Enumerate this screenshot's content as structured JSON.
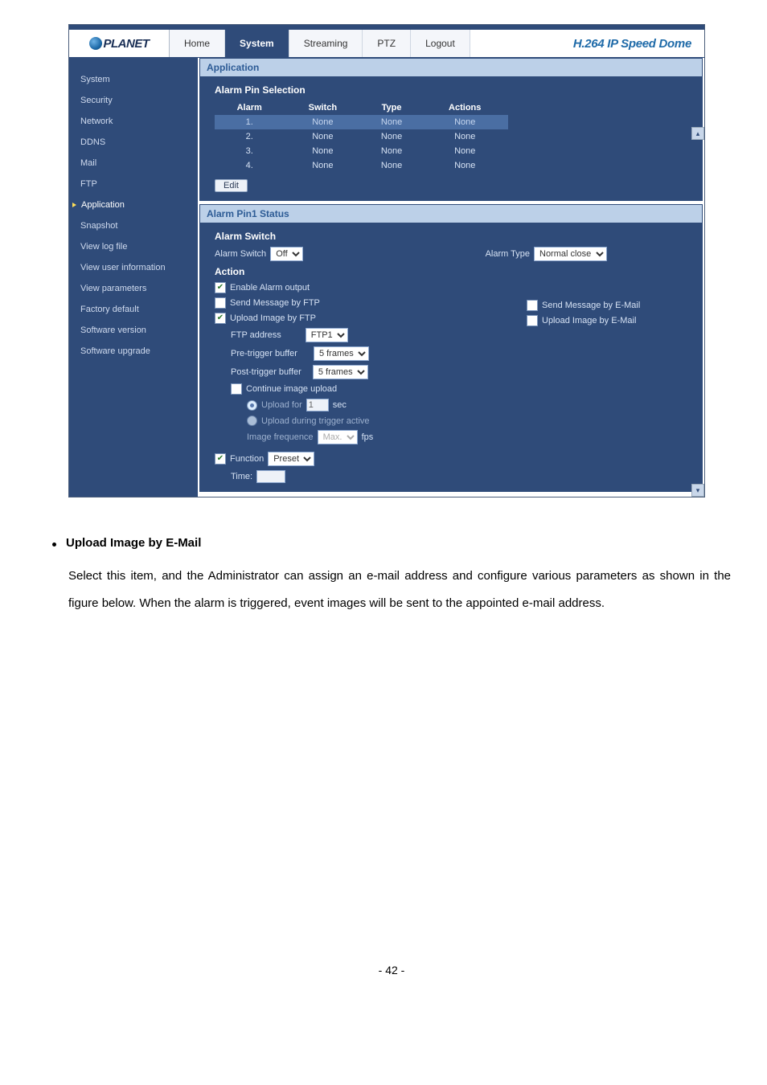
{
  "logo_text": "PLANET",
  "brand_slogan": "H.264 IP Speed Dome",
  "nav_tabs": [
    "Home",
    "System",
    "Streaming",
    "PTZ",
    "Logout"
  ],
  "nav_active_index": 1,
  "sidebar": {
    "items": [
      "System",
      "Security",
      "Network",
      "DDNS",
      "Mail",
      "FTP",
      "Application",
      "Snapshot",
      "View log file",
      "View user information",
      "View parameters",
      "Factory default",
      "Software version",
      "Software upgrade"
    ],
    "current_index": 6
  },
  "panel1": {
    "title": "Application",
    "sub": "Alarm Pin Selection",
    "columns": [
      "Alarm",
      "Switch",
      "Type",
      "Actions"
    ],
    "rows": [
      [
        "1.",
        "None",
        "None",
        "None"
      ],
      [
        "2.",
        "None",
        "None",
        "None"
      ],
      [
        "3.",
        "None",
        "None",
        "None"
      ],
      [
        "4.",
        "None",
        "None",
        "None"
      ]
    ],
    "selected_row": 0,
    "edit_label": "Edit"
  },
  "panel2": {
    "title": "Alarm Pin1 Status",
    "switch_sub": "Alarm Switch",
    "alarm_switch_label": "Alarm Switch",
    "alarm_switch_value": "Off",
    "alarm_type_label": "Alarm Type",
    "alarm_type_value": "Normal close",
    "action_label": "Action",
    "enable_alarm_output": "Enable Alarm output",
    "send_msg_ftp": "Send Message by FTP",
    "send_msg_email": "Send Message by E-Mail",
    "upload_img_ftp": "Upload Image by FTP",
    "upload_img_email": "Upload Image by E-Mail",
    "ftp_address_label": "FTP address",
    "ftp_address_value": "FTP1",
    "pre_trigger_label": "Pre-trigger buffer",
    "pre_trigger_value": "5  frames",
    "post_trigger_label": "Post-trigger buffer",
    "post_trigger_value": "5  frames",
    "continue_upload": "Continue image upload",
    "upload_for_label": "Upload for",
    "upload_for_value": "1",
    "upload_for_unit": "sec",
    "upload_during_active": "Upload during trigger active",
    "image_freq_label": "Image frequence",
    "image_freq_value": "Max.",
    "image_freq_unit": "fps",
    "function_label": "Function",
    "function_value": "Preset",
    "time_label": "Time:"
  },
  "doc": {
    "bullet_heading": "Upload Image by E-Mail",
    "paragraph": "Select this item, and the Administrator can assign an e-mail address and configure various parameters as shown in the figure below. When the alarm is triggered, event images will be sent to the appointed e-mail address.",
    "page_num": "- 42 -"
  }
}
